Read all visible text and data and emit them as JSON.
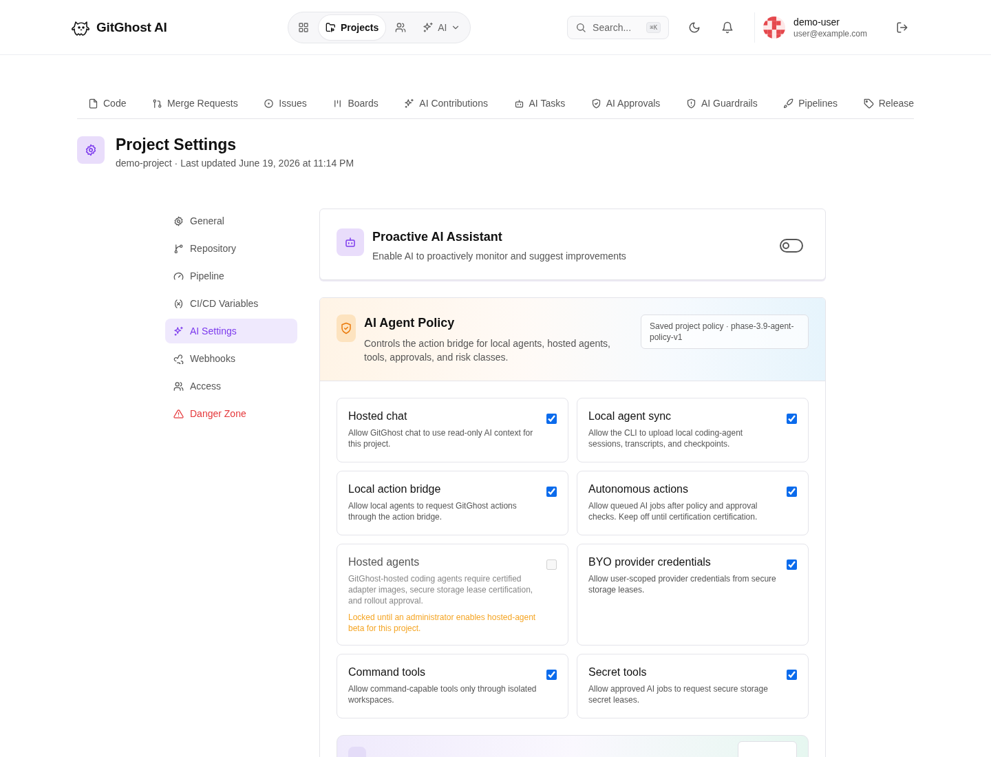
{
  "brand": {
    "name": "GitGhost AI"
  },
  "nav": [
    {
      "selected": false
    },
    {
      "label": "Projects",
      "selected": true
    },
    {
      "selected": false
    },
    {
      "label": "AI",
      "selected": false
    }
  ],
  "search": {
    "placeholder": "Search...",
    "shortcut": "⌘K"
  },
  "user": {
    "name": "demo-user",
    "email": "user@example.com"
  },
  "project_tabs": [
    "Code",
    "Merge Requests",
    "Issues",
    "Boards",
    "AI Contributions",
    "AI Tasks",
    "AI Approvals",
    "AI Guardrails",
    "Pipelines",
    "Release"
  ],
  "page": {
    "title": "Project Settings",
    "subtitle": "demo-project · Last updated June 19, 2026 at 11:14 PM"
  },
  "sidebar": {
    "items": [
      {
        "label": "General",
        "selected": false,
        "danger": false
      },
      {
        "label": "Repository",
        "selected": false,
        "danger": false
      },
      {
        "label": "Pipeline",
        "selected": false,
        "danger": false
      },
      {
        "label": "CI/CD Variables",
        "selected": false,
        "danger": false
      },
      {
        "label": "AI Settings",
        "selected": true,
        "danger": false
      },
      {
        "label": "Webhooks",
        "selected": false,
        "danger": false
      },
      {
        "label": "Access",
        "selected": false,
        "danger": false
      },
      {
        "label": "Danger Zone",
        "selected": false,
        "danger": true
      }
    ]
  },
  "assistant": {
    "title": "Proactive AI Assistant",
    "description": "Enable AI to proactively monitor and suggest improvements",
    "on": false
  },
  "policy": {
    "title": "AI Agent Policy",
    "description": "Controls the action bridge for local agents, hosted agents, tools, approvals, and risk classes.",
    "saved": "Saved project policy · phase-3.9-agent-policy-v1",
    "options": [
      {
        "title": "Hosted chat",
        "description": "Allow GitGhost chat to use read-only AI context for this project.",
        "checked": true,
        "disabled": false
      },
      {
        "title": "Local agent sync",
        "description": "Allow the CLI to upload local coding-agent sessions, transcripts, and checkpoints.",
        "checked": true,
        "disabled": false
      },
      {
        "title": "Local action bridge",
        "description": "Allow local agents to request GitGhost actions through the action bridge.",
        "checked": true,
        "disabled": false
      },
      {
        "title": "Autonomous actions",
        "description": "Allow queued AI jobs after policy and approval checks. Keep off until certification certification.",
        "checked": true,
        "disabled": false
      },
      {
        "title": "Hosted agents",
        "description": "GitGhost-hosted coding agents require certified adapter images, secure storage lease certification, and rollout approval.",
        "checked": false,
        "disabled": true,
        "note": "Locked until an administrator enables hosted-agent beta for this project."
      },
      {
        "title": "BYO provider credentials",
        "description": "Allow user-scoped provider credentials from secure storage leases.",
        "checked": true,
        "disabled": false
      },
      {
        "title": "Command tools",
        "description": "Allow command-capable tools only through isolated workspaces.",
        "checked": true,
        "disabled": false
      },
      {
        "title": "Secret tools",
        "description": "Allow approved AI jobs to request secure storage secret leases.",
        "checked": true,
        "disabled": false
      }
    ]
  }
}
